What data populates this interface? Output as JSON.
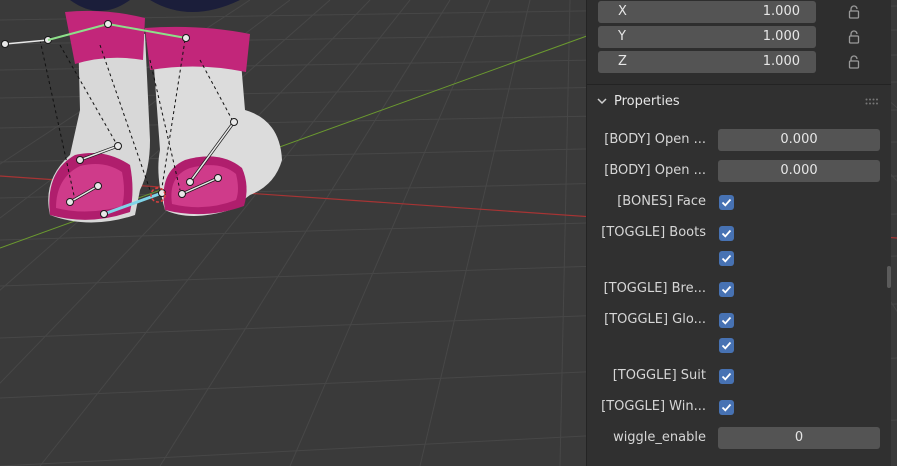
{
  "transform": {
    "rows": [
      {
        "axis": "X",
        "value": "1.000"
      },
      {
        "axis": "Y",
        "value": "1.000"
      },
      {
        "axis": "Z",
        "value": "1.000"
      }
    ]
  },
  "properties_panel": {
    "title": "Properties",
    "rows": [
      {
        "label": "[BODY] Open ...",
        "value": "0.000"
      },
      {
        "label": "[BODY] Open ...",
        "value": "0.000"
      },
      {
        "label": "[BONES] Face",
        "checked": true
      },
      {
        "label": "[TOGGLE] Boots",
        "checked": true
      },
      {
        "label": "",
        "checked": true
      },
      {
        "label": "[TOGGLE] Bre...",
        "checked": true
      },
      {
        "label": "[TOGGLE] Glo...",
        "checked": true
      },
      {
        "label": "",
        "checked": true
      },
      {
        "label": "[TOGGLE] Suit",
        "checked": true
      },
      {
        "label": "[TOGGLE] Win...",
        "checked": true
      },
      {
        "label": "wiggle_enable",
        "value": "0"
      }
    ]
  },
  "colors": {
    "viewport_bg": "#3a3a3a",
    "panel_bg": "#303030",
    "field_bg": "#545454",
    "checkbox_blue": "#4772b3",
    "x_axis_red": "#b23a3a",
    "y_axis_green": "#6b9a2f",
    "boot_pink": "#c2267a",
    "boot_white": "#d9d9d9",
    "bone_selected": "#7fd4e8"
  }
}
